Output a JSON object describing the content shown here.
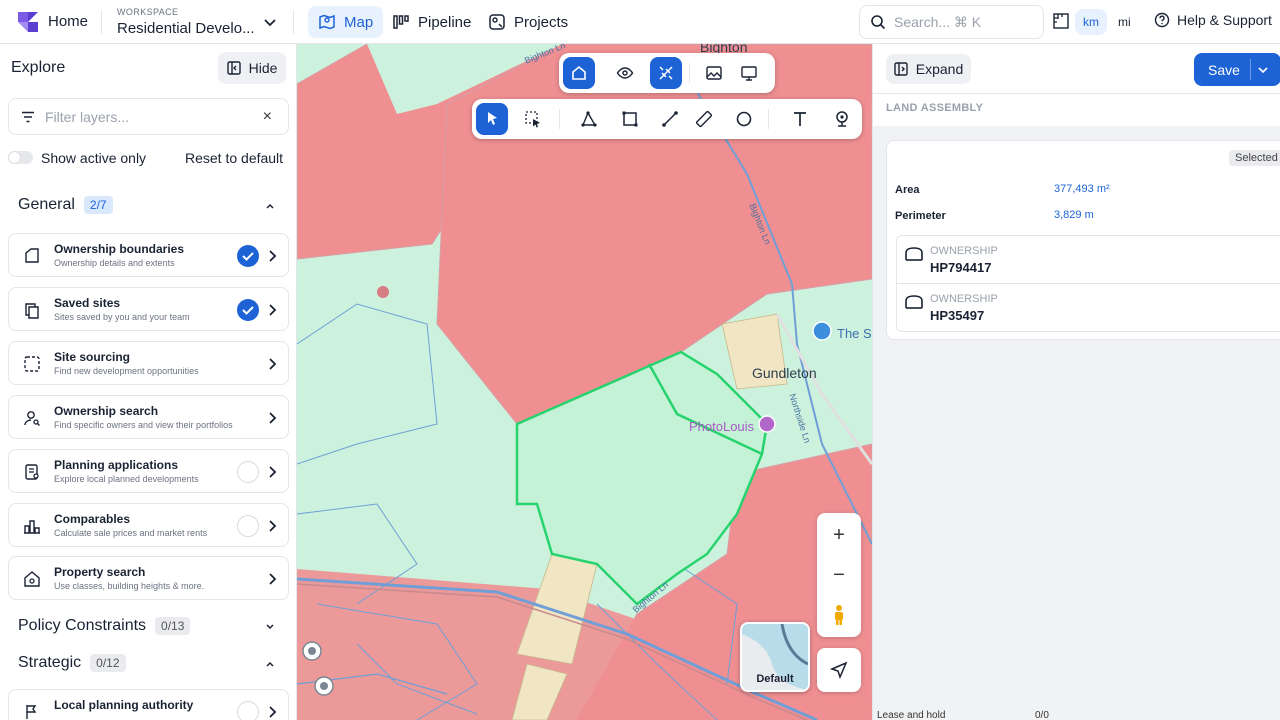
{
  "header": {
    "home_label": "Home",
    "workspace_label": "WORKSPACE",
    "workspace_name": "Residential Develo...",
    "nav": [
      {
        "label": "Map",
        "icon": "map-icon",
        "active": true
      },
      {
        "label": "Pipeline",
        "icon": "pipeline-icon",
        "active": false
      },
      {
        "label": "Projects",
        "icon": "projects-icon",
        "active": false
      }
    ],
    "search_placeholder": "Search... ⌘ K",
    "units": [
      "km",
      "mi"
    ],
    "active_unit": "km",
    "help_label": "Help & Support"
  },
  "explore": {
    "title": "Explore",
    "hide_label": "Hide",
    "filter_placeholder": "Filter layers...",
    "clear_glyph": "×",
    "show_active_label": "Show active only",
    "reset_label": "Reset to default",
    "sections": [
      {
        "title": "General",
        "count": "2/7",
        "expanded": true
      },
      {
        "title": "Policy Constraints",
        "count": "0/13",
        "expanded": false
      },
      {
        "title": "Strategic",
        "count": "0/12",
        "expanded": true
      }
    ],
    "layers": [
      {
        "title": "Ownership boundaries",
        "subtitle": "Ownership details and extents",
        "icon": "ownership-boundary-icon",
        "checked": true
      },
      {
        "title": "Saved sites",
        "subtitle": "Sites saved by you and your team",
        "icon": "saved-sites-icon",
        "checked": true
      },
      {
        "title": "Site sourcing",
        "subtitle": "Find new development opportunities",
        "icon": "site-sourcing-icon",
        "checked": null
      },
      {
        "title": "Ownership search",
        "subtitle": "Find specific owners and view their portfolios",
        "icon": "ownership-search-icon",
        "checked": null
      },
      {
        "title": "Planning applications",
        "subtitle": "Explore local planned developments",
        "icon": "planning-icon",
        "checked": false
      },
      {
        "title": "Comparables",
        "subtitle": "Calculate sale prices and market rents",
        "icon": "comparables-icon",
        "checked": false
      },
      {
        "title": "Property search",
        "subtitle": "Use classes, building heights & more.",
        "icon": "property-search-icon",
        "checked": null
      },
      {
        "title": "Local planning authority",
        "subtitle": "",
        "icon": "planning-authority-icon",
        "checked": false
      }
    ]
  },
  "map": {
    "place_labels": [
      "Bighton",
      "Gundleton",
      "PhotoLouis",
      "The S"
    ],
    "road_labels": [
      "Bighton Ln",
      "Bighton Ln",
      "Northside Ln",
      "Bighton Ln"
    ],
    "basemap_label": "Default",
    "zoom_in": "+",
    "zoom_out": "−",
    "colors": {
      "owned": "#ef8f92",
      "land": "#ccf2dd",
      "selected_outline": "#27d36d",
      "yellow": "#f0e6c4",
      "roads": "#6f9fd6"
    }
  },
  "panel": {
    "expand_label": "Expand",
    "save_label": "Save",
    "section_title": "LAND ASSEMBLY",
    "selected_badge": "Selected",
    "stats": [
      {
        "label": "Area",
        "value": "377,493 m²"
      },
      {
        "label": "Perimeter",
        "value": "3,829 m"
      }
    ],
    "ownerships": [
      {
        "label": "OWNERSHIP",
        "value": "HP794417"
      },
      {
        "label": "OWNERSHIP",
        "value": "HP35497"
      }
    ],
    "cut_off_label": "Lease and hold",
    "cut_off_value": "0/0"
  },
  "accent_color": "#1d63d6"
}
